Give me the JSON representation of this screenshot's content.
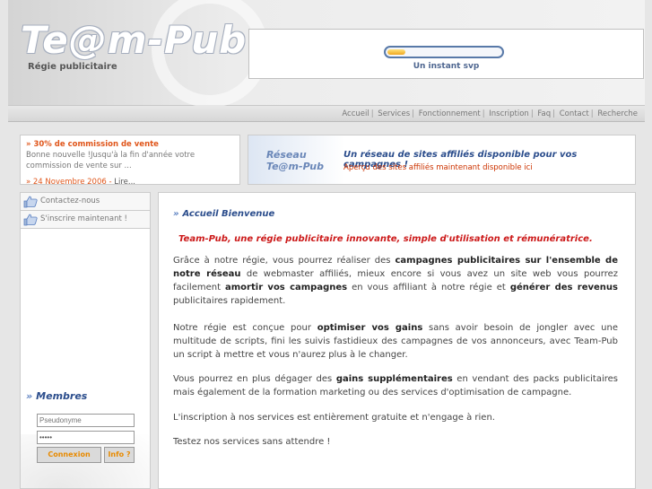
{
  "header": {
    "logo": "Te@m-Pub",
    "tagline": "Régie publicitaire",
    "loader": {
      "text": "Un instant svp",
      "progress": 0.15
    }
  },
  "nav": {
    "items": [
      "Accueil",
      "Services",
      "Fonctionnement",
      "Inscription",
      "Faq",
      "Contact",
      "Recherche"
    ]
  },
  "news": {
    "title": "» 30% de commission de vente",
    "body": "Bonne nouvelle !Jusqu'à la fin d'année votre commission de vente sur ...",
    "date": "» 24 Novembre 2006 - ",
    "more": "Lire..."
  },
  "reseau": {
    "logo_line1": "Réseau",
    "logo_line2": "Te@m-Pub",
    "title": "Un réseau de sites affiliés disponible pour vos campagnes !",
    "subtitle": "Aperçu des sites affiliés maintenant disponible ici"
  },
  "sidebar": {
    "links": [
      "Contactez-nous",
      "S'inscrire maintenant !"
    ],
    "members_title": "Membres",
    "username_placeholder": "Pseudonyme",
    "password_value": "*****",
    "login_button": "Connexion",
    "info_button": "Info ?"
  },
  "content": {
    "title": "Accueil Bienvenue",
    "intro": "Team-Pub, une régie publicitaire innovante, simple d'utilisation et rémunératrice.",
    "p1": {
      "a": "Grâce à notre régie, vous pourrez réaliser des ",
      "b": "campagnes publicitaires sur l'ensemble de notre réseau",
      "c": " de webmaster affiliés, mieux encore si vous avez un site web vous pourrez facilement ",
      "d": "amortir vos campagnes",
      "e": " en vous affiliant à notre régie et ",
      "f": "générer des revenus",
      "g": " publicitaires rapidement."
    },
    "p2": {
      "a": "Notre régie est conçue pour ",
      "b": "optimiser vos gains",
      "c": " sans avoir besoin de jongler avec une multitude de scripts, fini les suivis fastidieux des campagnes de vos annonceurs, avec Team-Pub un script à mettre et vous n'aurez plus à le changer."
    },
    "p3": {
      "a": "Vous pourrez en plus dégager des ",
      "b": "gains supplémentaires",
      "c": " en vendant des packs publicitaires mais également de la formation marketing ou des services d'optimisation de campagne."
    },
    "p4": "L'inscription à nos services est entièrement gratuite et n'engage à rien.",
    "p5": "Testez nos services sans attendre !"
  }
}
